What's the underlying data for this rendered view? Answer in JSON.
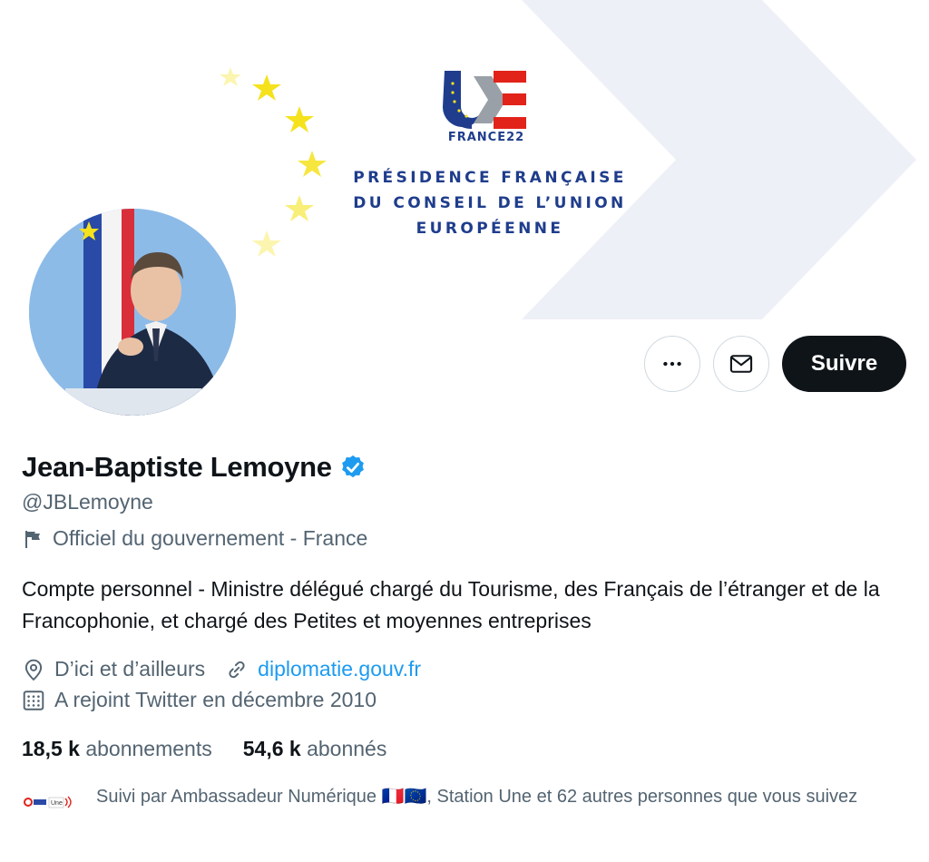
{
  "banner": {
    "logo_sub": "FRANCE22",
    "presidency_lines": [
      "PRÉSIDENCE FRANÇAISE",
      "DU CONSEIL DE L’UNION",
      "EUROPÉENNE"
    ],
    "colors": {
      "navy": "#1f3d8c",
      "red": "#e2231a",
      "star": "#f5e21c",
      "chevron": "#eef0f7"
    }
  },
  "actions": {
    "more_icon": "more-horizontal-icon",
    "message_icon": "envelope-icon",
    "follow_label": "Suivre"
  },
  "profile": {
    "name": "Jean-Baptiste Lemoyne",
    "verified_icon": "verified-badge-icon",
    "handle": "@JBLemoyne",
    "affiliation_icon": "flag-icon",
    "affiliation": "Officiel du gouvernement - France",
    "bio": "Compte personnel - Ministre délégué chargé du Tourisme, des Français de l’étranger et de la Francophonie, et chargé des Petites et moyennes entreprises",
    "location_icon": "location-pin-icon",
    "location": "D’ici et d’ailleurs",
    "url_icon": "link-icon",
    "url": "diplomatie.gouv.fr",
    "joined_icon": "calendar-icon",
    "joined": "A rejoint Twitter en décembre 2010",
    "following_count": "18,5 k",
    "following_label": "abonnements",
    "followers_count": "54,6 k",
    "followers_label": "abonnés"
  },
  "followed_by": {
    "text": "Suivi par Ambassadeur Numérique 🇫🇷🇪🇺, Station Une et 62 autres personnes que vous suivez",
    "avatar_label": "Une"
  },
  "colors": {
    "accent": "#1d9bf0",
    "text": "#0f1419",
    "secondary": "#536471",
    "border": "#cfd9de"
  }
}
